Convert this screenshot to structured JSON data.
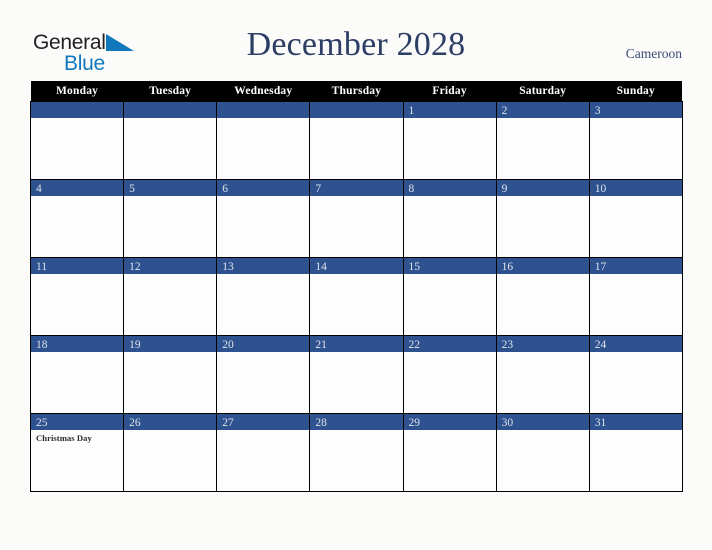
{
  "brand": {
    "name_part1": "General",
    "name_part2": "Blue",
    "triangle_color": "#1278be",
    "text_color": "#231f20"
  },
  "header": {
    "title": "December 2028",
    "country": "Cameroon",
    "title_color": "#2c3e64"
  },
  "calendar": {
    "weekday_headers": [
      "Monday",
      "Tuesday",
      "Wednesday",
      "Thursday",
      "Friday",
      "Saturday",
      "Sunday"
    ],
    "header_bg": "#000000",
    "header_text_color": "#ffffff",
    "daybar_bg": "#2e5190",
    "daynum_color": "#dfe3ea",
    "cell_bg": "#fdfdfd",
    "weeks": [
      [
        {
          "day": "",
          "events": []
        },
        {
          "day": "",
          "events": []
        },
        {
          "day": "",
          "events": []
        },
        {
          "day": "",
          "events": []
        },
        {
          "day": "1",
          "events": []
        },
        {
          "day": "2",
          "events": []
        },
        {
          "day": "3",
          "events": []
        }
      ],
      [
        {
          "day": "4",
          "events": []
        },
        {
          "day": "5",
          "events": []
        },
        {
          "day": "6",
          "events": []
        },
        {
          "day": "7",
          "events": []
        },
        {
          "day": "8",
          "events": []
        },
        {
          "day": "9",
          "events": []
        },
        {
          "day": "10",
          "events": []
        }
      ],
      [
        {
          "day": "11",
          "events": []
        },
        {
          "day": "12",
          "events": []
        },
        {
          "day": "13",
          "events": []
        },
        {
          "day": "14",
          "events": []
        },
        {
          "day": "15",
          "events": []
        },
        {
          "day": "16",
          "events": []
        },
        {
          "day": "17",
          "events": []
        }
      ],
      [
        {
          "day": "18",
          "events": []
        },
        {
          "day": "19",
          "events": []
        },
        {
          "day": "20",
          "events": []
        },
        {
          "day": "21",
          "events": []
        },
        {
          "day": "22",
          "events": []
        },
        {
          "day": "23",
          "events": []
        },
        {
          "day": "24",
          "events": []
        }
      ],
      [
        {
          "day": "25",
          "events": [
            "Christmas Day"
          ]
        },
        {
          "day": "26",
          "events": []
        },
        {
          "day": "27",
          "events": []
        },
        {
          "day": "28",
          "events": []
        },
        {
          "day": "29",
          "events": []
        },
        {
          "day": "30",
          "events": []
        },
        {
          "day": "31",
          "events": []
        }
      ]
    ]
  }
}
